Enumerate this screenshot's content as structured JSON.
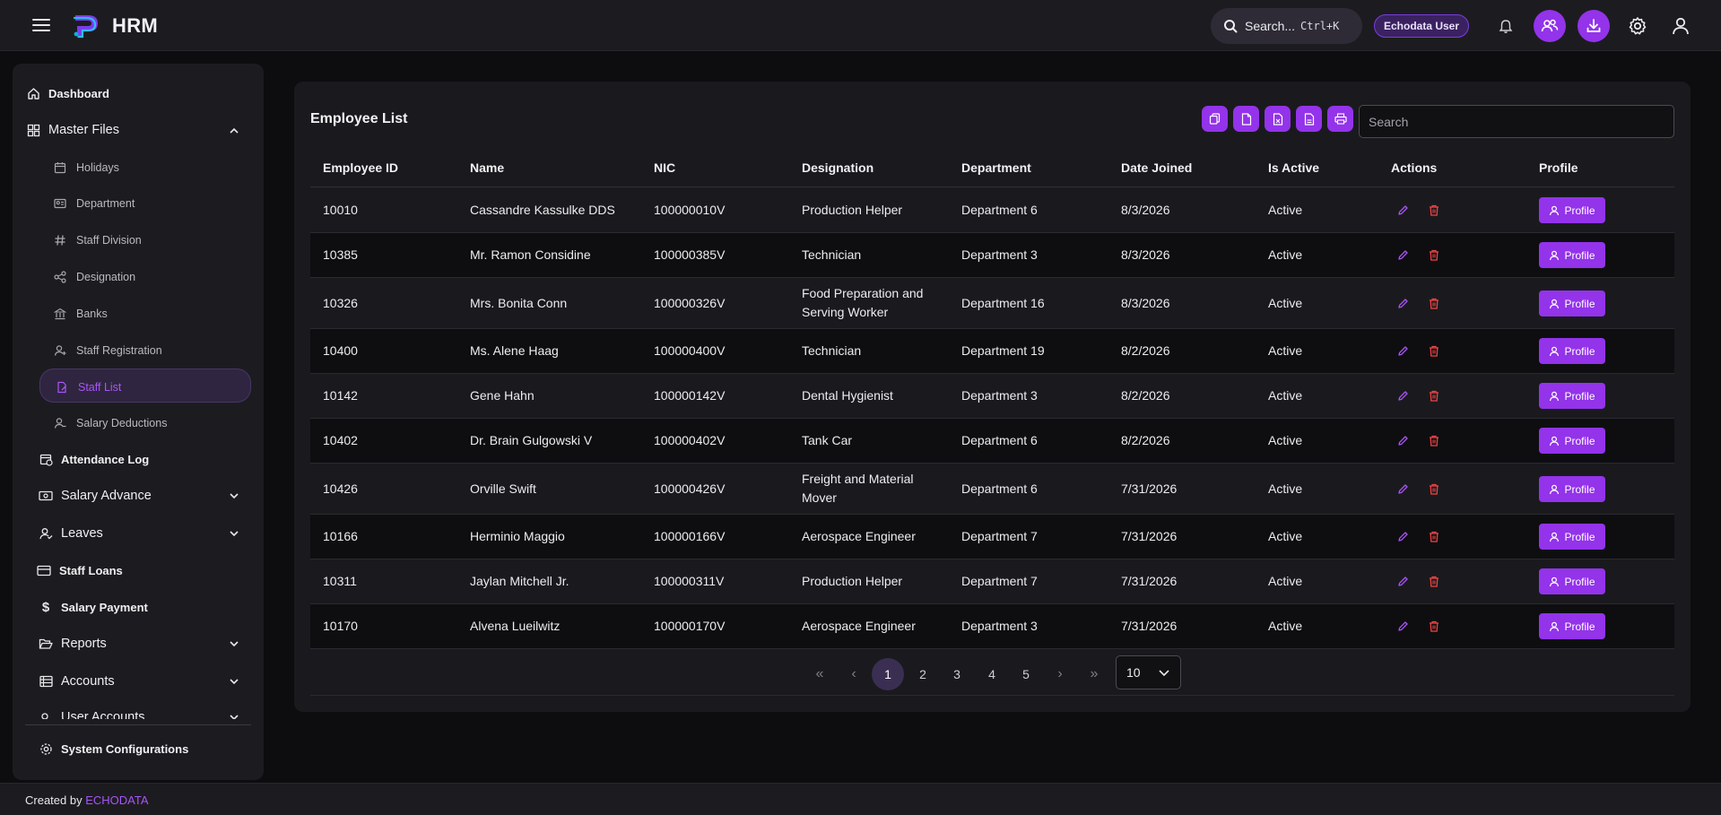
{
  "header": {
    "app_title": "HRM",
    "search_label": "Search...",
    "search_shortcut": "Ctrl+K",
    "user_chip": "Echodata User",
    "icons": [
      "menu-icon",
      "bell-icon",
      "users-icon",
      "download-icon",
      "gear-icon",
      "user-icon"
    ]
  },
  "sidebar": {
    "dashboard": "Dashboard",
    "master_files": "Master Files",
    "sub": {
      "holidays": "Holidays",
      "department": "Department",
      "staff_division": "Staff Division",
      "designation": "Designation",
      "banks": "Banks",
      "staff_registration": "Staff Registration",
      "staff_list": "Staff List",
      "salary_deductions": "Salary Deductions"
    },
    "attendance_log": "Attendance Log",
    "salary_advance": "Salary Advance",
    "leaves": "Leaves",
    "staff_loans": "Staff Loans",
    "salary_payment": "Salary Payment",
    "reports": "Reports",
    "accounts": "Accounts",
    "user_accounts": "User Accounts",
    "system_configurations": "System Configurations"
  },
  "main": {
    "title": "Employee List",
    "search_placeholder": "Search",
    "export_icons": [
      "copy-icon",
      "csv-icon",
      "excel-icon",
      "pdf-icon",
      "print-icon"
    ],
    "columns": [
      "Employee ID",
      "Name",
      "NIC",
      "Designation",
      "Department",
      "Date Joined",
      "Is Active",
      "Actions",
      "Profile"
    ],
    "profile_label": "Profile",
    "rows": [
      {
        "id": "10010",
        "name": "Cassandre Kassulke DDS",
        "nic": "100000010V",
        "designation": "Production Helper",
        "department": "Department 6",
        "date_joined": "8/3/2026",
        "active": "Active"
      },
      {
        "id": "10385",
        "name": "Mr. Ramon Considine",
        "nic": "100000385V",
        "designation": "Technician",
        "department": "Department 3",
        "date_joined": "8/3/2026",
        "active": "Active"
      },
      {
        "id": "10326",
        "name": "Mrs. Bonita Conn",
        "nic": "100000326V",
        "designation": "Food Preparation and Serving Worker",
        "department": "Department 16",
        "date_joined": "8/3/2026",
        "active": "Active"
      },
      {
        "id": "10400",
        "name": "Ms. Alene Haag",
        "nic": "100000400V",
        "designation": "Technician",
        "department": "Department 19",
        "date_joined": "8/2/2026",
        "active": "Active"
      },
      {
        "id": "10142",
        "name": "Gene Hahn",
        "nic": "100000142V",
        "designation": "Dental Hygienist",
        "department": "Department 3",
        "date_joined": "8/2/2026",
        "active": "Active"
      },
      {
        "id": "10402",
        "name": "Dr. Brain Gulgowski V",
        "nic": "100000402V",
        "designation": "Tank Car",
        "department": "Department 6",
        "date_joined": "8/2/2026",
        "active": "Active"
      },
      {
        "id": "10426",
        "name": "Orville Swift",
        "nic": "100000426V",
        "designation": "Freight and Material Mover",
        "department": "Department 6",
        "date_joined": "7/31/2026",
        "active": "Active"
      },
      {
        "id": "10166",
        "name": "Herminio Maggio",
        "nic": "100000166V",
        "designation": "Aerospace Engineer",
        "department": "Department 7",
        "date_joined": "7/31/2026",
        "active": "Active"
      },
      {
        "id": "10311",
        "name": "Jaylan Mitchell Jr.",
        "nic": "100000311V",
        "designation": "Production Helper",
        "department": "Department 7",
        "date_joined": "7/31/2026",
        "active": "Active"
      },
      {
        "id": "10170",
        "name": "Alvena Lueilwitz",
        "nic": "100000170V",
        "designation": "Aerospace Engineer",
        "department": "Department 3",
        "date_joined": "7/31/2026",
        "active": "Active"
      }
    ],
    "pagination": {
      "first": "«",
      "prev": "‹",
      "pages": [
        "1",
        "2",
        "3",
        "4",
        "5"
      ],
      "current": "1",
      "next": "›",
      "last": "»",
      "per_page": "10"
    }
  },
  "footer": {
    "created_by": "Created by",
    "brand": "ECHODATA"
  },
  "colors": {
    "accent": "#9333ea",
    "danger": "#ef4444",
    "background": "#0d0d10",
    "surface": "#1c1c20"
  }
}
